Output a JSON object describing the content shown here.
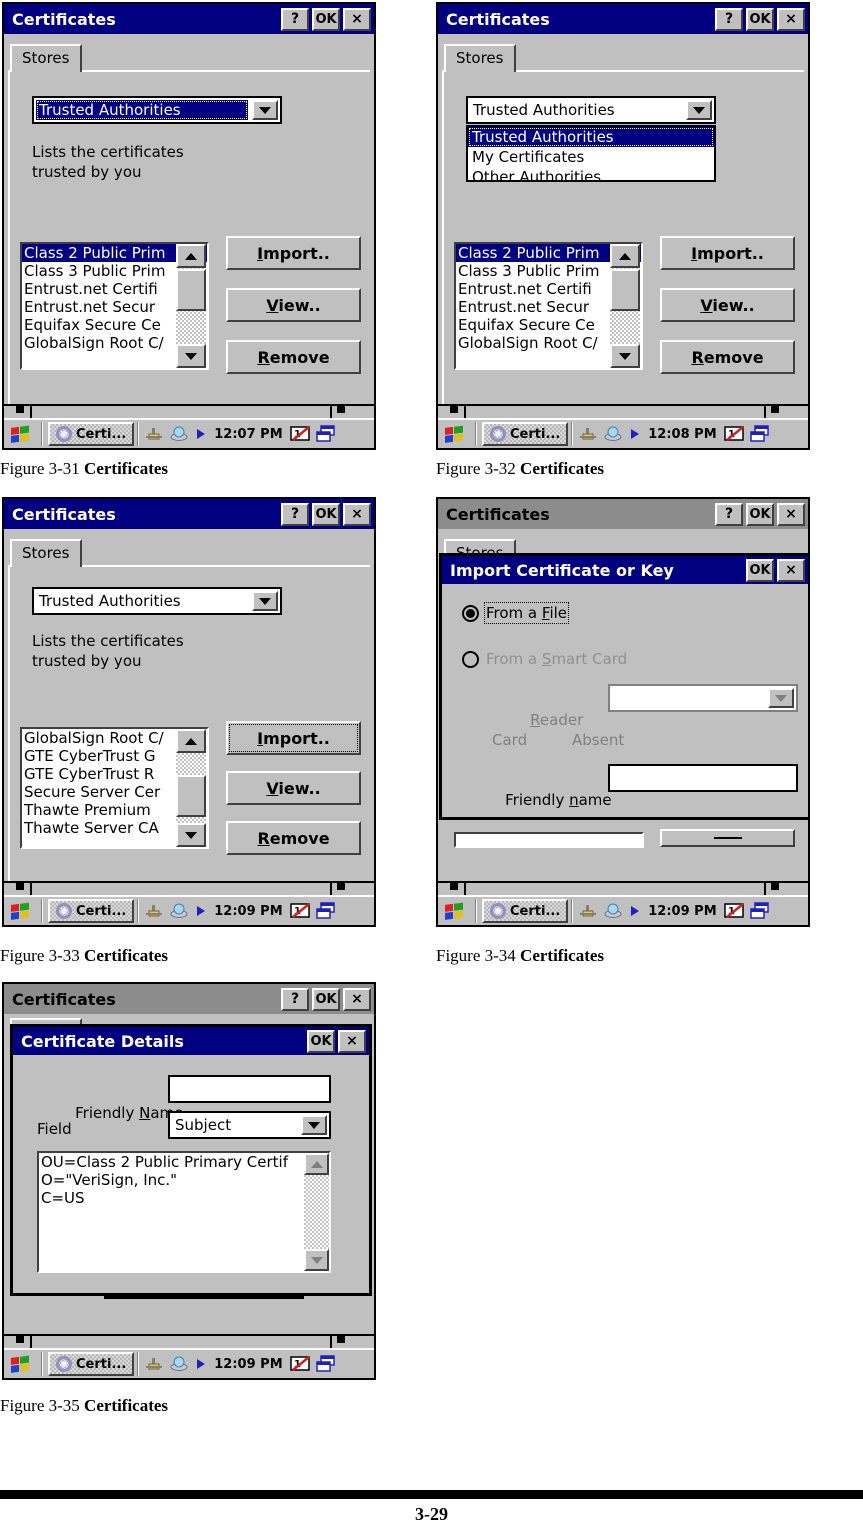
{
  "document": {
    "page_number": "3-29",
    "captions": [
      {
        "number": "Figure 3-31 ",
        "title": "Certificates"
      },
      {
        "number": "Figure 3-32 ",
        "title": "Certificates"
      },
      {
        "number": "Figure 3-33 ",
        "title": "Certificates"
      },
      {
        "number": "Figure 3-34 ",
        "title": "Certificates"
      },
      {
        "number": "Figure 3-35 ",
        "title": "Certificates"
      }
    ]
  },
  "common": {
    "window_title": "Certificates",
    "help_btn": "?",
    "ok_btn": "OK",
    "close_btn": "×",
    "tab_stores": "Stores",
    "store_description": "Lists the certificates\ntrusted by you",
    "buttons": {
      "import": "Import..",
      "import_accel": "I",
      "import_rest": "mport..",
      "view": "View..",
      "view_accel": "V",
      "view_rest": "iew..",
      "remove": "Remove",
      "remove_accel": "R",
      "remove_rest": "emove"
    },
    "taskbar": {
      "start_icon": "windows-flag-icon",
      "task_label": "Certi...",
      "task_icon": "gear-icon",
      "tray_icons": [
        "connection-icon",
        "network-icon",
        "play-arrow-icon",
        "date-pen-icon",
        "windows-tasks-icon"
      ]
    }
  },
  "fig31": {
    "title": "Certificates",
    "tab": "Stores",
    "combo_value": "Trusted Authorities",
    "description": "Lists the certificates\ntrusted by you",
    "cert_list": [
      "Class 2 Public Prim",
      "Class 3 Public Prim",
      "Entrust.net Certifi",
      "Entrust.net Secur",
      "Equifax Secure Ce",
      "GlobalSign Root C/"
    ],
    "selected_index": 0,
    "clock": "12:07 PM"
  },
  "fig32": {
    "title": "Certificates",
    "tab": "Stores",
    "combo_value": "Trusted Authorities",
    "dropdown_options": [
      "Trusted Authorities",
      "My Certificates",
      "Other Authorities"
    ],
    "dropdown_selected_index": 0,
    "cert_list": [
      "Class 2 Public Prim",
      "Class 3 Public Prim",
      "Entrust.net Certifi",
      "Entrust.net Secur",
      "Equifax Secure Ce",
      "GlobalSign Root C/"
    ],
    "selected_index": 0,
    "clock": "12:08 PM"
  },
  "fig33": {
    "title": "Certificates",
    "tab": "Stores",
    "combo_value": "Trusted Authorities",
    "description": "Lists the certificates\ntrusted by you",
    "cert_list": [
      "GlobalSign Root C/",
      "GTE CyberTrust G",
      "GTE CyberTrust R",
      "Secure Server Cer",
      "Thawte Premium",
      "Thawte Server CA"
    ],
    "selected_index": -1,
    "clock": "12:09 PM"
  },
  "fig34": {
    "parent_title": "Certificates",
    "parent_tab": "Stores",
    "dialog_title": "Import Certificate or Key",
    "dialog_ok": "OK",
    "dialog_close": "×",
    "radio_file_label": "From a File",
    "radio_file_accel": "F",
    "radio_smartcard_label": "From a Smart Card",
    "radio_smartcard_accel": "S",
    "reader_label": "Reader",
    "reader_accel": "R",
    "reader_value": "",
    "card_label": "Card",
    "card_status": "Absent",
    "friendly_name_label": "Friendly name",
    "friendly_name_accel": "n",
    "friendly_name_value": "",
    "clock": "12:09 PM"
  },
  "fig35": {
    "parent_title": "Certificates",
    "dialog_title": "Certificate Details",
    "dialog_ok": "OK",
    "dialog_close": "×",
    "friendly_name_label": "Friendly Name",
    "friendly_name_accel": "N",
    "friendly_name_value": "",
    "field_label": "Field",
    "field_value": "Subject",
    "detail_lines": [
      "OU=Class 2 Public Primary Certif",
      "O=\"VeriSign, Inc.\"",
      "C=US"
    ],
    "clock": "12:09 PM"
  }
}
